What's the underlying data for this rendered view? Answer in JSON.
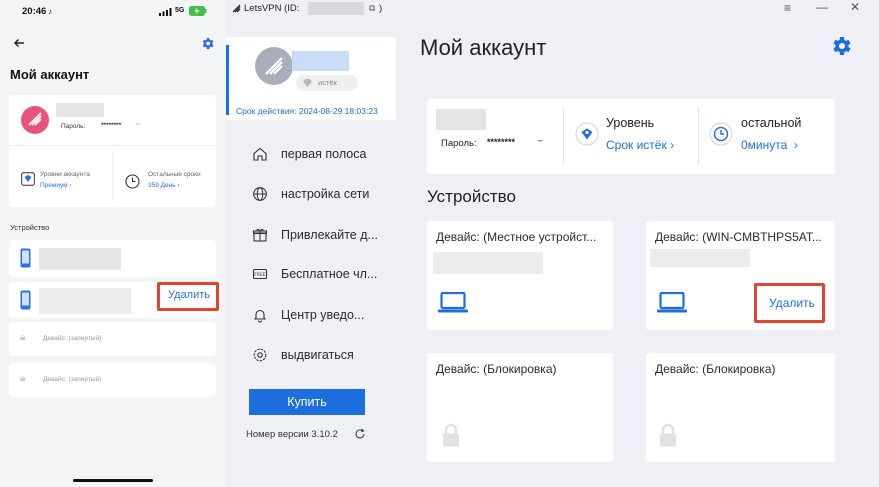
{
  "mobile": {
    "status": {
      "time": "20:46",
      "network": "5G"
    },
    "title": "Мой аккаунт",
    "account": {
      "password_label": "Пароль:",
      "password_mask": "********",
      "level_label": "Уровни аккаунта",
      "level_value": "Премиум",
      "remaining_label": "Остальные сроки",
      "remaining_value": "359 День"
    },
    "devices_header": "Устройство",
    "delete_label": "Удалить",
    "locked_device_1": "Девайс: (запертый)",
    "locked_device_2": "Девайс: (запертый)"
  },
  "app": {
    "window_title": "LetsVPN (ID:",
    "window_title_end": ")",
    "badge_text": "истёк",
    "expiry": "Срок действия: 2024-08-29 18:03:23",
    "nav": [
      {
        "label": "первая полоса",
        "icon": "home-icon"
      },
      {
        "label": "настройка сети",
        "icon": "globe-icon"
      },
      {
        "label": "Привлекайте д...",
        "icon": "gift-icon"
      },
      {
        "label": "Бесплатное чл...",
        "icon": "free-icon"
      },
      {
        "label": "Центр уведо...",
        "icon": "bell-icon"
      },
      {
        "label": "выдвигаться",
        "icon": "settings-icon"
      }
    ],
    "buy_button": "Купить",
    "version": "Номер версии 3.10.2"
  },
  "main": {
    "title": "Мой аккаунт",
    "password_label": "Пароль:",
    "password_mask": "********",
    "level_label": "Уровень",
    "level_value": "Срок истёк",
    "remaining_label": "остальной",
    "remaining_value": "0минута",
    "devices_header": "Устройство",
    "devices": [
      {
        "title": "Девайс: (Местное устройст..."
      },
      {
        "title": "Девайс: (WIN-CMBTHPS5AT...",
        "action": "Удалить"
      },
      {
        "title": "Девайс: (Блокировка)"
      },
      {
        "title": "Девайс: (Блокировка)"
      }
    ]
  },
  "colors": {
    "accent": "#1d6fe0",
    "highlight": "#e2442f",
    "sidebar_bg": "#eef0f5"
  }
}
